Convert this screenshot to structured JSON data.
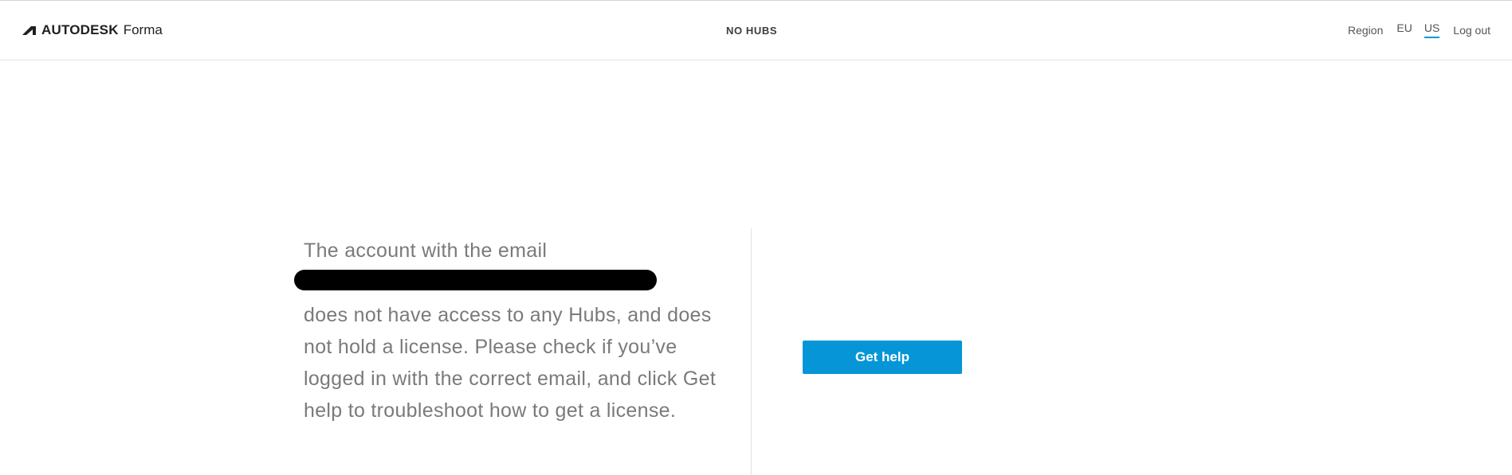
{
  "header": {
    "brand_name": "AUTODESK",
    "product_name": "Forma",
    "hub_title": "NO HUBS",
    "region_label": "Region",
    "regions": [
      {
        "label": "EU",
        "active": false
      },
      {
        "label": "US",
        "active": true
      }
    ],
    "logout_label": "Log out"
  },
  "main": {
    "message_line1": "The account with the email",
    "message_rest": "does not have access to any Hubs, and does not hold a license. Please check if you’ve logged in with the correct email, and click Get help to troubleshoot how to get a license.",
    "help_button_label": "Get help"
  },
  "colors": {
    "accent": "#0696d7",
    "text_muted": "#7a7a7a",
    "redaction": "#000000"
  },
  "icons": {
    "brand_logo": "autodesk-logo-icon"
  }
}
